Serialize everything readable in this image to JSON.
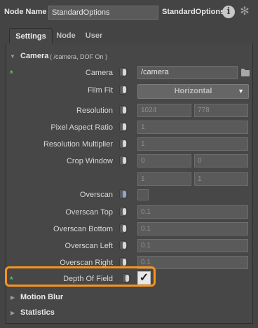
{
  "header": {
    "node_name_label": "Node Name",
    "node_name_value": "StandardOptions",
    "node_type": "StandardOptions",
    "info_icon": "info-icon",
    "settings_icon": "gear-icon"
  },
  "tabs": [
    {
      "label": "Settings",
      "active": true
    },
    {
      "label": "Node",
      "active": false
    },
    {
      "label": "User",
      "active": false
    }
  ],
  "camera_section": {
    "title": "Camera",
    "subtitle": "( /camera, DOF On )",
    "expanded": true,
    "rows": {
      "camera": {
        "label": "Camera",
        "value": "/camera",
        "modified": true
      },
      "film_fit": {
        "label": "Film Fit",
        "value": "Horizontal"
      },
      "resolution": {
        "label": "Resolution",
        "x": "1024",
        "y": "778"
      },
      "pixel_aspect_ratio": {
        "label": "Pixel Aspect Ratio",
        "value": "1"
      },
      "resolution_multiplier": {
        "label": "Resolution Multiplier",
        "value": "1"
      },
      "crop_window": {
        "label": "Crop Window",
        "values": [
          "0",
          "0",
          "1",
          "1"
        ]
      },
      "overscan": {
        "label": "Overscan",
        "checked": false
      },
      "overscan_top": {
        "label": "Overscan Top",
        "value": "0.1"
      },
      "overscan_bottom": {
        "label": "Overscan Bottom",
        "value": "0.1"
      },
      "overscan_left": {
        "label": "Overscan Left",
        "value": "0.1"
      },
      "overscan_right": {
        "label": "Overscan Right",
        "value": "0.1"
      },
      "depth_of_field": {
        "label": "Depth Of Field",
        "checked": true,
        "modified": true
      }
    }
  },
  "collapsed_sections": [
    {
      "title": "Motion Blur"
    },
    {
      "title": "Statistics"
    }
  ],
  "glyphs": {
    "modified_marker": "*",
    "expanded_arrow": "▼",
    "collapsed_arrow": "▶",
    "dropdown_arrow": "▼",
    "checkmark": "✓",
    "info_letter": "i",
    "gear": "✻"
  },
  "colors": {
    "highlight": "#f7941d",
    "modified_marker": "#39d353",
    "background": "#444444"
  }
}
